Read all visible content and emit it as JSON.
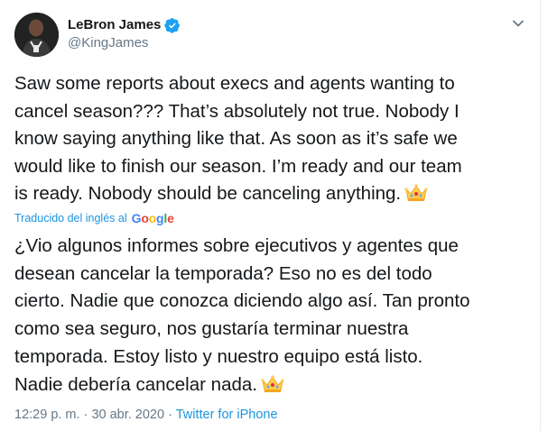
{
  "user": {
    "display_name": "LeBron James",
    "handle": "@KingJames"
  },
  "tweet": {
    "lines": [
      "Saw some reports about execs and agents wanting to",
      "cancel season??? That’s absolutely not true. Nobody I",
      "know saying anything like that. As soon as it’s safe we",
      "would like to finish our season. I’m ready and our team",
      "is ready.  Nobody should be canceling anything."
    ]
  },
  "translation": {
    "label": "Traducido del inglés al",
    "provider": "Google",
    "lines": [
      "¿Vio algunos informes sobre ejecutivos y agentes que",
      "desean cancelar la temporada? Eso no es del todo",
      "cierto. Nadie que conozca diciendo algo así. Tan pronto",
      "como sea seguro, nos gustaría terminar nuestra",
      "temporada. Estoy listo y nuestro equipo está listo.",
      "Nadie debería cancelar nada."
    ]
  },
  "meta": {
    "time": "12:29 p. m.",
    "separator": " · ",
    "date": "30 abr. 2020",
    "source": "Twitter for iPhone"
  },
  "colors": {
    "link": "#1b95e0",
    "muted": "#657786",
    "verified": "#1da1f2"
  },
  "icons": [
    "verified-badge-icon",
    "chevron-down-icon",
    "crown-emoji-icon"
  ]
}
